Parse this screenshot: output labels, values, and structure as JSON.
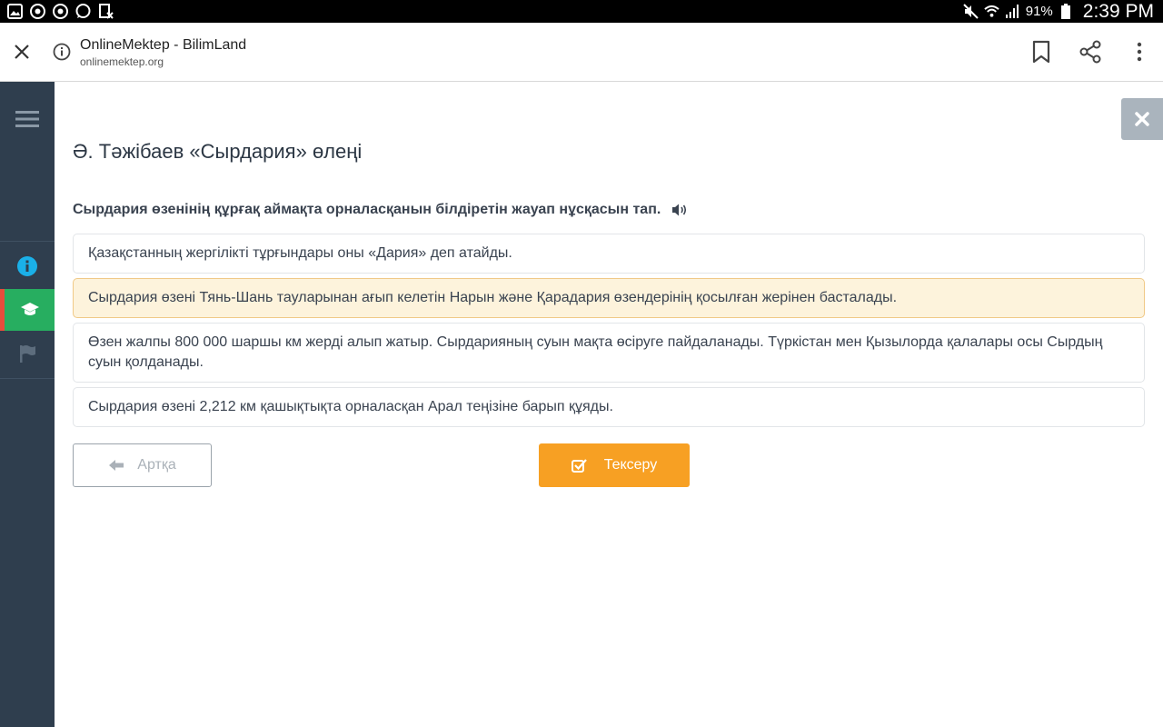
{
  "statusbar": {
    "battery": "91%",
    "time": "2:39 PM"
  },
  "browser": {
    "title": "OnlineMektep - BilimLand",
    "url": "onlinemektep.org"
  },
  "lesson": {
    "title": "Ә. Тәжібаев «Сырдария» өлеңі",
    "question": "Сырдария өзенінің құрғақ аймақта орналасқанын білдіретін жауап нұсқасын тап.",
    "options": [
      "Қазақстанның жергілікті тұрғындары оны «Дария» деп атайды.",
      "Сырдария өзені Тянь-Шань тауларынан ағып келетін Нарын және Қарадария өзендерінің қосылған жерінен басталады.",
      "Өзен жалпы 800 000 шаршы км жерді алып жатыр. Сырдарияның суын мақта өсіруге пайдаланады. Түркістан мен Қызылорда қалалары осы Сырдың суын қолданады.",
      "Сырдария өзені 2,212 км қашықтықта орналасқан Арал теңізіне барып құяды."
    ],
    "selected_option": 1
  },
  "buttons": {
    "back_label": "Артқа",
    "check_label": "Тексеру"
  },
  "colors": {
    "sidebar": "#2f3e4e",
    "active_item": "#27ae60",
    "accent": "#f7a023",
    "selected_bg": "#fdf3dc",
    "info_icon": "#1ab0e8"
  }
}
